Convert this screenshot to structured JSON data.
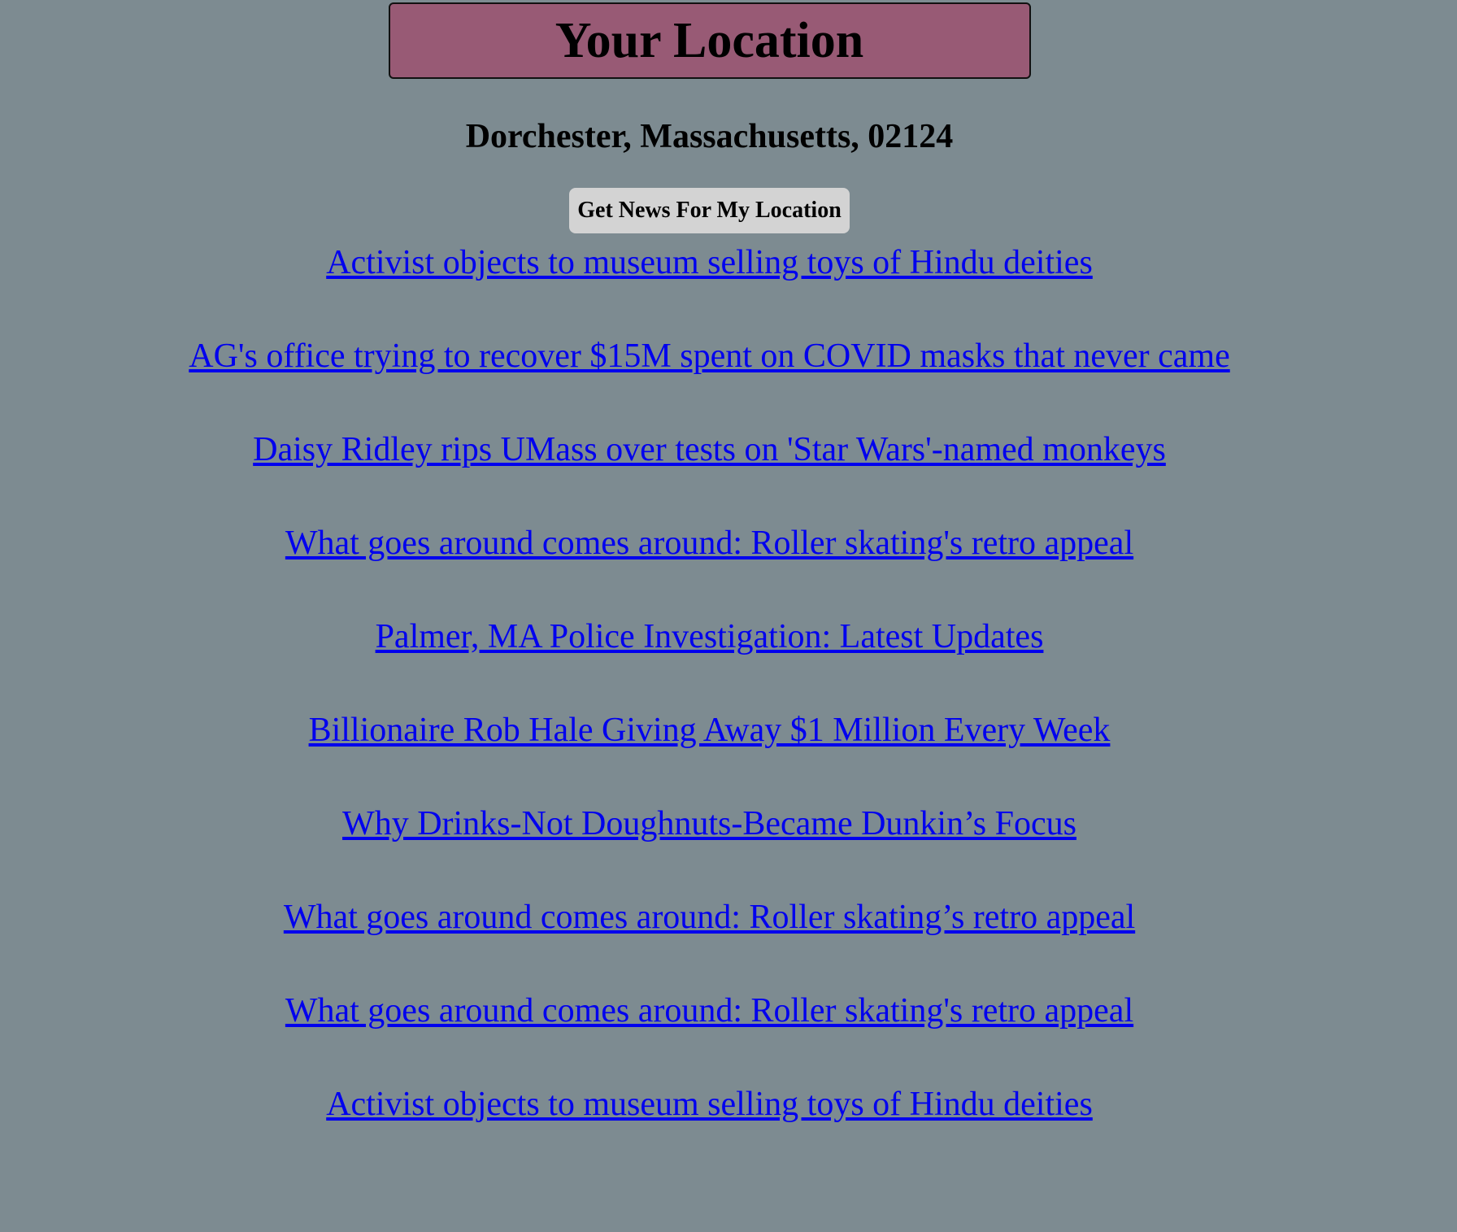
{
  "header": {
    "title": "Your Location"
  },
  "location": "Dorchester, Massachusetts, 02124",
  "button_label": "Get News For My Location",
  "news": [
    "Activist objects to museum selling toys of Hindu deities",
    "AG's office trying to recover $15M spent on COVID masks that never came",
    "Daisy Ridley rips UMass over tests on 'Star Wars'-named monkeys",
    "What goes around comes around: Roller skating's retro appeal",
    "Palmer, MA Police Investigation: Latest Updates",
    "Billionaire Rob Hale Giving Away $1 Million Every Week",
    "Why Drinks-Not Doughnuts-Became Dunkin’s Focus",
    "What goes around comes around: Roller skating’s retro appeal",
    "What goes around comes around: Roller skating's retro appeal",
    "Activist objects to museum selling toys of Hindu deities"
  ]
}
